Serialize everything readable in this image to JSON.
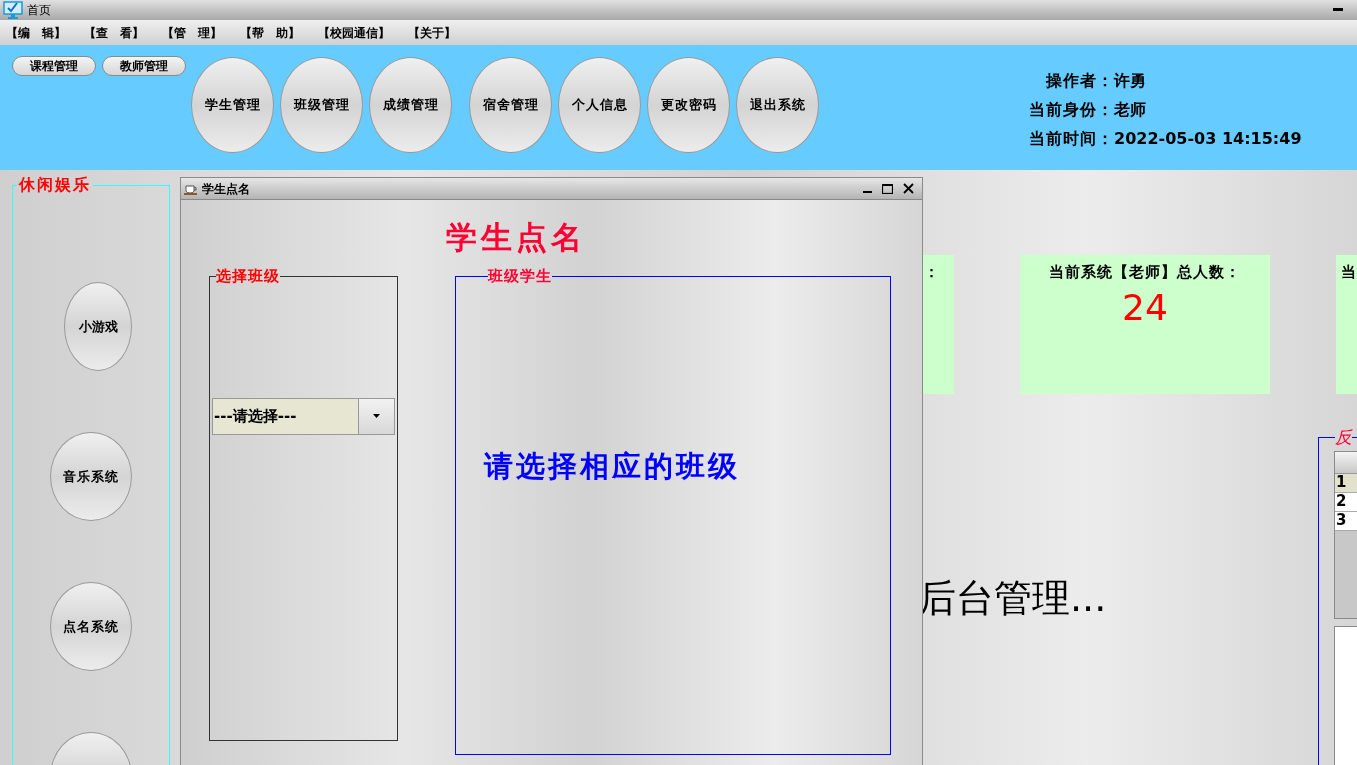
{
  "window": {
    "title": "首页"
  },
  "menu": [
    "【编　辑】",
    "【查　看】",
    "【管　理】",
    "【帮　助】",
    "【校园通信】",
    "【关于】"
  ],
  "toolbar": {
    "small_buttons": [
      "课程管理",
      "教师管理"
    ],
    "oval_groups": [
      [
        "学生管理",
        "班级管理",
        "成绩管理"
      ],
      [
        "宿舍管理",
        "个人信息",
        "更改密码",
        "退出系统"
      ]
    ]
  },
  "user_info": [
    {
      "label": "操作者：",
      "value": "许勇"
    },
    {
      "label": "当前身份：",
      "value": "老师"
    },
    {
      "label": "当前时间：",
      "value": "2022-05-03 14:15:49"
    }
  ],
  "leisure_panel": {
    "title": "休闲娱乐",
    "items": [
      {
        "kind": "narrow",
        "label": "小游戏"
      },
      {
        "kind": "wide",
        "label": "音乐系统"
      },
      {
        "kind": "wide",
        "label": "点名系统"
      },
      {
        "kind": "blank"
      }
    ]
  },
  "stat_cards": [
    {
      "label": "："
    },
    {
      "label": "当前系统【老师】总人数：",
      "value": "24"
    },
    {
      "label": "当"
    }
  ],
  "backdrop_text": "后台管理...",
  "feedback_panel": {
    "title": "反",
    "rows": [
      {
        "number": "1",
        "selected": true
      },
      {
        "number": "2",
        "selected": false
      },
      {
        "number": "3",
        "selected": false
      }
    ]
  },
  "dialog": {
    "title": "学生点名",
    "heading": "学生点名",
    "class_group": {
      "title": "选择班级",
      "dropdown": "---请选择---"
    },
    "students_group": {
      "title": "班级学生",
      "message": "请选择相应的班级"
    }
  }
}
